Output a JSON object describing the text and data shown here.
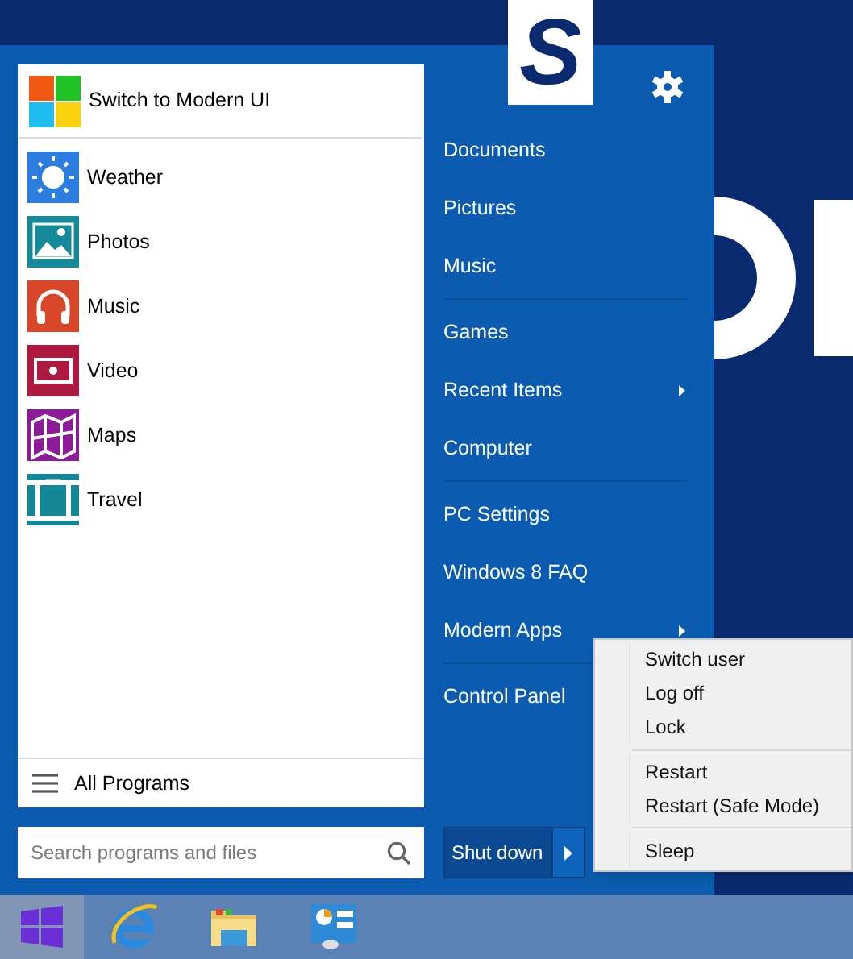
{
  "wallpaper": {
    "logo": "S"
  },
  "left_panel": {
    "switch_item": {
      "label": "Switch to Modern UI"
    },
    "apps": [
      {
        "label": "Weather",
        "kind": "weather",
        "color": "#2b7de0"
      },
      {
        "label": "Photos",
        "kind": "photos",
        "color": "#16899a"
      },
      {
        "label": "Music",
        "kind": "music",
        "color": "#d9472b"
      },
      {
        "label": "Video",
        "kind": "video",
        "color": "#ae1a3f"
      },
      {
        "label": "Maps",
        "kind": "maps",
        "color": "#8d1b99"
      },
      {
        "label": "Travel",
        "kind": "travel",
        "color": "#148797"
      }
    ],
    "all_programs": "All Programs"
  },
  "search": {
    "placeholder": "Search programs and files"
  },
  "places": [
    [
      {
        "label": "Documents",
        "has_submenu": false
      },
      {
        "label": "Pictures",
        "has_submenu": false
      },
      {
        "label": "Music",
        "has_submenu": false
      }
    ],
    [
      {
        "label": "Games",
        "has_submenu": false
      },
      {
        "label": "Recent Items",
        "has_submenu": true
      },
      {
        "label": "Computer",
        "has_submenu": false
      }
    ],
    [
      {
        "label": "PC Settings",
        "has_submenu": false
      },
      {
        "label": "Windows 8 FAQ",
        "has_submenu": false
      },
      {
        "label": "Modern Apps",
        "has_submenu": true
      }
    ],
    [
      {
        "label": "Control Panel",
        "has_submenu": false
      }
    ]
  ],
  "shutdown": {
    "label": "Shut down",
    "expanded": true
  },
  "power_menu": [
    [
      "Switch user",
      "Log off",
      "Lock"
    ],
    [
      "Restart",
      "Restart (Safe Mode)"
    ],
    [
      "Sleep"
    ]
  ],
  "taskbar": {
    "start_selected": true,
    "apps": [
      {
        "kind": "browser"
      },
      {
        "kind": "folder"
      },
      {
        "kind": "control-panel"
      }
    ]
  }
}
